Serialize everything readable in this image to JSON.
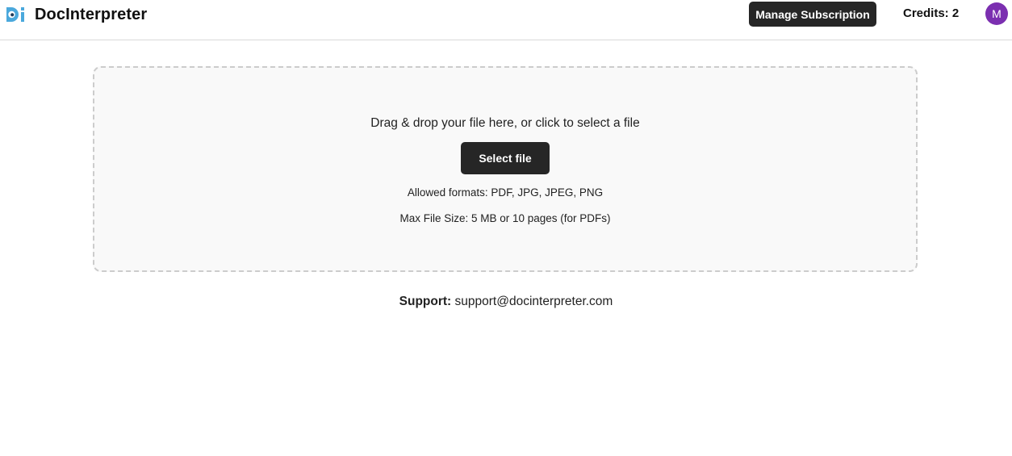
{
  "header": {
    "brand_name": "DocInterpreter",
    "logo_icon": "docinterpreter-logo",
    "manage_subscription_label": "Manage Subscription",
    "credits_text": "Credits: 2",
    "avatar_initial": "M",
    "avatar_color": "#7b2fb0",
    "logo_color": "#4aa8dc"
  },
  "upload": {
    "prompt": "Drag & drop your file here, or click to select a file",
    "select_button_label": "Select file",
    "allowed_formats": "Allowed formats: PDF, JPG, JPEG, PNG",
    "max_size": "Max File Size: 5 MB or 10 pages (for PDFs)"
  },
  "support": {
    "label": "Support:",
    "email": "support@docinterpreter.com"
  },
  "colors": {
    "button_bg": "#262626",
    "dropzone_bg": "#f9f9f9",
    "dropzone_border": "#cccccc"
  }
}
